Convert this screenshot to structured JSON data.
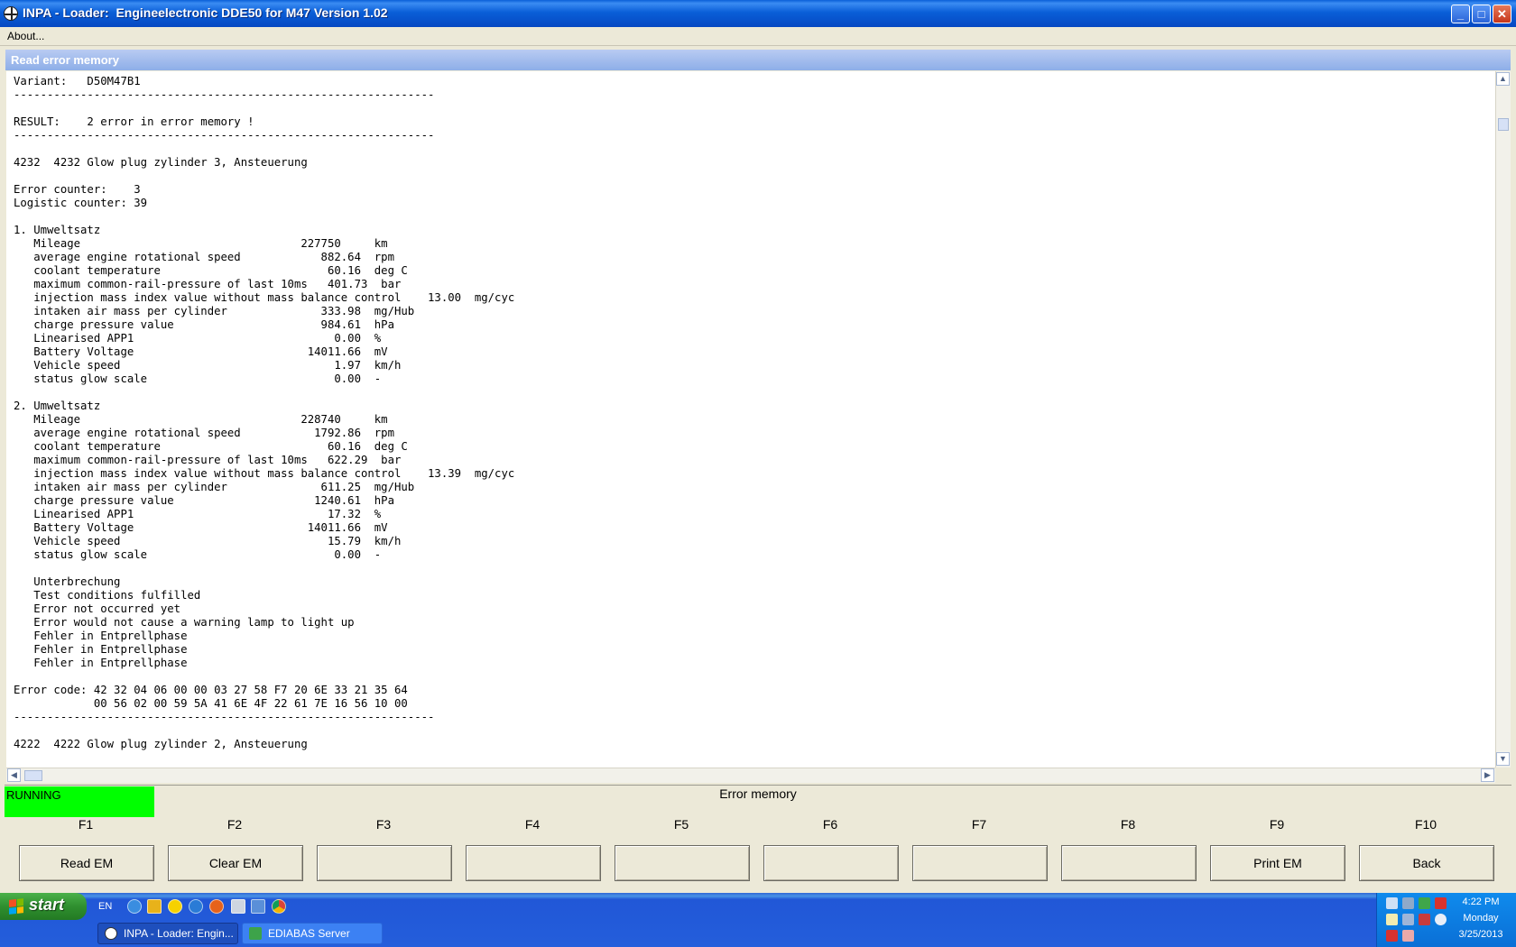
{
  "window": {
    "title": "INPA - Loader:  Engineelectronic DDE50 for M47 Version 1.02",
    "minimize_glyph": "_",
    "maximize_glyph": "□",
    "close_glyph": "✕"
  },
  "menu": {
    "about_label": "About..."
  },
  "panel": {
    "title": "Read error memory"
  },
  "output_lines": [
    "Variant:   D50M47B1",
    "---------------------------------------------------------------",
    "",
    "RESULT:    2 error in error memory !",
    "---------------------------------------------------------------",
    "",
    "4232  4232 Glow plug zylinder 3, Ansteuerung",
    "",
    "Error counter:    3",
    "Logistic counter: 39",
    "",
    "1. Umweltsatz",
    "   Mileage                                 227750     km",
    "   average engine rotational speed            882.64  rpm",
    "   coolant temperature                         60.16  deg C",
    "   maximum common-rail-pressure of last 10ms   401.73  bar",
    "   injection mass index value without mass balance control    13.00  mg/cyc",
    "   intaken air mass per cylinder              333.98  mg/Hub",
    "   charge pressure value                      984.61  hPa",
    "   Linearised APP1                              0.00  %",
    "   Battery Voltage                          14011.66  mV",
    "   Vehicle speed                                1.97  km/h",
    "   status glow scale                            0.00  -",
    "",
    "2. Umweltsatz",
    "   Mileage                                 228740     km",
    "   average engine rotational speed           1792.86  rpm",
    "   coolant temperature                         60.16  deg C",
    "   maximum common-rail-pressure of last 10ms   622.29  bar",
    "   injection mass index value without mass balance control    13.39  mg/cyc",
    "   intaken air mass per cylinder              611.25  mg/Hub",
    "   charge pressure value                     1240.61  hPa",
    "   Linearised APP1                             17.32  %",
    "   Battery Voltage                          14011.66  mV",
    "   Vehicle speed                               15.79  km/h",
    "   status glow scale                            0.00  -",
    "",
    "   Unterbrechung",
    "   Test conditions fulfilled",
    "   Error not occurred yet",
    "   Error would not cause a warning lamp to light up",
    "   Fehler in Entprellphase",
    "   Fehler in Entprellphase",
    "   Fehler in Entprellphase",
    "",
    "Error code: 42 32 04 06 00 00 03 27 58 F7 20 6E 33 21 35 64",
    "            00 56 02 00 59 5A 41 6E 4F 22 61 7E 16 56 10 00",
    "---------------------------------------------------------------",
    "",
    "4222  4222 Glow plug zylinder 2, Ansteuerung"
  ],
  "status": {
    "running_label": "RUNNING",
    "running_color": "#00ff00",
    "title": "Error memory"
  },
  "function_keys": [
    {
      "key": "F1",
      "label": "Read EM"
    },
    {
      "key": "F2",
      "label": "Clear EM"
    },
    {
      "key": "F3",
      "label": ""
    },
    {
      "key": "F4",
      "label": ""
    },
    {
      "key": "F5",
      "label": ""
    },
    {
      "key": "F6",
      "label": ""
    },
    {
      "key": "F7",
      "label": ""
    },
    {
      "key": "F8",
      "label": ""
    },
    {
      "key": "F9",
      "label": "Print EM"
    },
    {
      "key": "F10",
      "label": "Back"
    }
  ],
  "taskbar": {
    "start_label": "start",
    "language": "EN",
    "tasks": [
      {
        "label": "INPA - Loader:  Engin...",
        "active": true
      },
      {
        "label": "EDIABAS Server",
        "active": false
      }
    ],
    "clock": {
      "time": "4:22 PM",
      "day": "Monday",
      "date": "3/25/2013"
    }
  },
  "colors": {
    "titlebar": "#0a5fd8",
    "panel_title": "#8daee8",
    "running": "#00ff00",
    "taskbar": "#245edb",
    "start_button": "#2f8f2f"
  }
}
